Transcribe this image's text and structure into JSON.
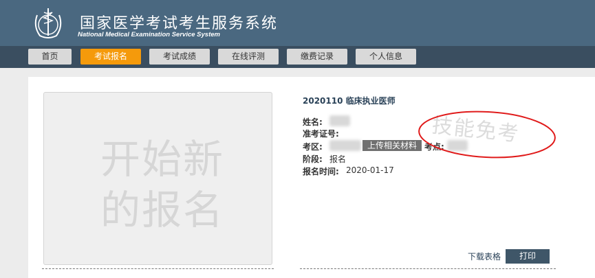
{
  "header": {
    "title": "国家医学考试考生服务系统",
    "subtitle": "National Medical Examination Service System"
  },
  "nav": {
    "items": [
      {
        "label": "首页"
      },
      {
        "label": "考试报名"
      },
      {
        "label": "考试成绩"
      },
      {
        "label": "在线评测"
      },
      {
        "label": "缴费记录"
      },
      {
        "label": "个人信息"
      }
    ],
    "active_index": 1
  },
  "new_registration": {
    "text": "开始新的报名"
  },
  "registration": {
    "title": "2020110 临床执业医师",
    "name_label": "姓名:",
    "ticket_label": "准考证号:",
    "area_label": "考区:",
    "upload_button": "上传相关材料",
    "site_label": "考点:",
    "stage_label": "阶段:",
    "stage_value": "报名",
    "date_label": "报名时间:",
    "date_value": "2020-01-17"
  },
  "stamp": {
    "text": "技能免考",
    "ellipse_color": "#e01a1a"
  },
  "actions": {
    "download_label": "下载表格",
    "print_label": "打印"
  }
}
